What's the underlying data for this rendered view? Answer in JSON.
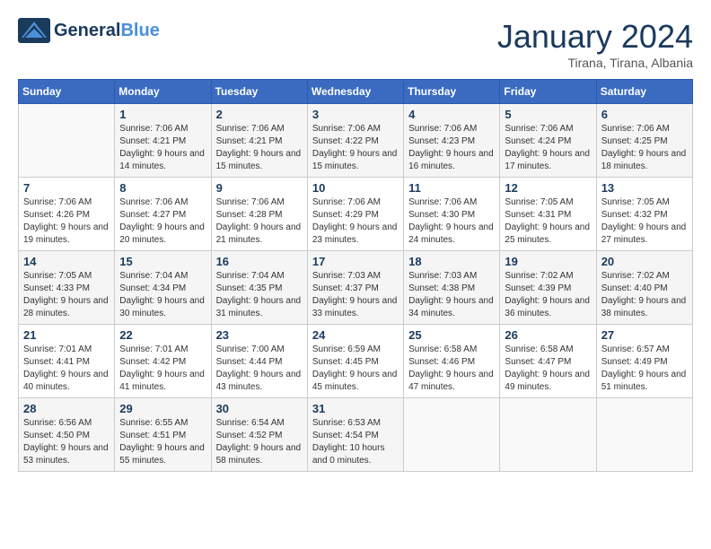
{
  "header": {
    "logo_general": "General",
    "logo_blue": "Blue",
    "month_title": "January 2024",
    "subtitle": "Tirana, Tirana, Albania"
  },
  "days_of_week": [
    "Sunday",
    "Monday",
    "Tuesday",
    "Wednesday",
    "Thursday",
    "Friday",
    "Saturday"
  ],
  "weeks": [
    [
      {
        "day": "",
        "sunrise": "",
        "sunset": "",
        "daylight": ""
      },
      {
        "day": "1",
        "sunrise": "Sunrise: 7:06 AM",
        "sunset": "Sunset: 4:21 PM",
        "daylight": "Daylight: 9 hours and 14 minutes."
      },
      {
        "day": "2",
        "sunrise": "Sunrise: 7:06 AM",
        "sunset": "Sunset: 4:21 PM",
        "daylight": "Daylight: 9 hours and 15 minutes."
      },
      {
        "day": "3",
        "sunrise": "Sunrise: 7:06 AM",
        "sunset": "Sunset: 4:22 PM",
        "daylight": "Daylight: 9 hours and 15 minutes."
      },
      {
        "day": "4",
        "sunrise": "Sunrise: 7:06 AM",
        "sunset": "Sunset: 4:23 PM",
        "daylight": "Daylight: 9 hours and 16 minutes."
      },
      {
        "day": "5",
        "sunrise": "Sunrise: 7:06 AM",
        "sunset": "Sunset: 4:24 PM",
        "daylight": "Daylight: 9 hours and 17 minutes."
      },
      {
        "day": "6",
        "sunrise": "Sunrise: 7:06 AM",
        "sunset": "Sunset: 4:25 PM",
        "daylight": "Daylight: 9 hours and 18 minutes."
      }
    ],
    [
      {
        "day": "7",
        "sunrise": "Sunrise: 7:06 AM",
        "sunset": "Sunset: 4:26 PM",
        "daylight": "Daylight: 9 hours and 19 minutes."
      },
      {
        "day": "8",
        "sunrise": "Sunrise: 7:06 AM",
        "sunset": "Sunset: 4:27 PM",
        "daylight": "Daylight: 9 hours and 20 minutes."
      },
      {
        "day": "9",
        "sunrise": "Sunrise: 7:06 AM",
        "sunset": "Sunset: 4:28 PM",
        "daylight": "Daylight: 9 hours and 21 minutes."
      },
      {
        "day": "10",
        "sunrise": "Sunrise: 7:06 AM",
        "sunset": "Sunset: 4:29 PM",
        "daylight": "Daylight: 9 hours and 23 minutes."
      },
      {
        "day": "11",
        "sunrise": "Sunrise: 7:06 AM",
        "sunset": "Sunset: 4:30 PM",
        "daylight": "Daylight: 9 hours and 24 minutes."
      },
      {
        "day": "12",
        "sunrise": "Sunrise: 7:05 AM",
        "sunset": "Sunset: 4:31 PM",
        "daylight": "Daylight: 9 hours and 25 minutes."
      },
      {
        "day": "13",
        "sunrise": "Sunrise: 7:05 AM",
        "sunset": "Sunset: 4:32 PM",
        "daylight": "Daylight: 9 hours and 27 minutes."
      }
    ],
    [
      {
        "day": "14",
        "sunrise": "Sunrise: 7:05 AM",
        "sunset": "Sunset: 4:33 PM",
        "daylight": "Daylight: 9 hours and 28 minutes."
      },
      {
        "day": "15",
        "sunrise": "Sunrise: 7:04 AM",
        "sunset": "Sunset: 4:34 PM",
        "daylight": "Daylight: 9 hours and 30 minutes."
      },
      {
        "day": "16",
        "sunrise": "Sunrise: 7:04 AM",
        "sunset": "Sunset: 4:35 PM",
        "daylight": "Daylight: 9 hours and 31 minutes."
      },
      {
        "day": "17",
        "sunrise": "Sunrise: 7:03 AM",
        "sunset": "Sunset: 4:37 PM",
        "daylight": "Daylight: 9 hours and 33 minutes."
      },
      {
        "day": "18",
        "sunrise": "Sunrise: 7:03 AM",
        "sunset": "Sunset: 4:38 PM",
        "daylight": "Daylight: 9 hours and 34 minutes."
      },
      {
        "day": "19",
        "sunrise": "Sunrise: 7:02 AM",
        "sunset": "Sunset: 4:39 PM",
        "daylight": "Daylight: 9 hours and 36 minutes."
      },
      {
        "day": "20",
        "sunrise": "Sunrise: 7:02 AM",
        "sunset": "Sunset: 4:40 PM",
        "daylight": "Daylight: 9 hours and 38 minutes."
      }
    ],
    [
      {
        "day": "21",
        "sunrise": "Sunrise: 7:01 AM",
        "sunset": "Sunset: 4:41 PM",
        "daylight": "Daylight: 9 hours and 40 minutes."
      },
      {
        "day": "22",
        "sunrise": "Sunrise: 7:01 AM",
        "sunset": "Sunset: 4:42 PM",
        "daylight": "Daylight: 9 hours and 41 minutes."
      },
      {
        "day": "23",
        "sunrise": "Sunrise: 7:00 AM",
        "sunset": "Sunset: 4:44 PM",
        "daylight": "Daylight: 9 hours and 43 minutes."
      },
      {
        "day": "24",
        "sunrise": "Sunrise: 6:59 AM",
        "sunset": "Sunset: 4:45 PM",
        "daylight": "Daylight: 9 hours and 45 minutes."
      },
      {
        "day": "25",
        "sunrise": "Sunrise: 6:58 AM",
        "sunset": "Sunset: 4:46 PM",
        "daylight": "Daylight: 9 hours and 47 minutes."
      },
      {
        "day": "26",
        "sunrise": "Sunrise: 6:58 AM",
        "sunset": "Sunset: 4:47 PM",
        "daylight": "Daylight: 9 hours and 49 minutes."
      },
      {
        "day": "27",
        "sunrise": "Sunrise: 6:57 AM",
        "sunset": "Sunset: 4:49 PM",
        "daylight": "Daylight: 9 hours and 51 minutes."
      }
    ],
    [
      {
        "day": "28",
        "sunrise": "Sunrise: 6:56 AM",
        "sunset": "Sunset: 4:50 PM",
        "daylight": "Daylight: 9 hours and 53 minutes."
      },
      {
        "day": "29",
        "sunrise": "Sunrise: 6:55 AM",
        "sunset": "Sunset: 4:51 PM",
        "daylight": "Daylight: 9 hours and 55 minutes."
      },
      {
        "day": "30",
        "sunrise": "Sunrise: 6:54 AM",
        "sunset": "Sunset: 4:52 PM",
        "daylight": "Daylight: 9 hours and 58 minutes."
      },
      {
        "day": "31",
        "sunrise": "Sunrise: 6:53 AM",
        "sunset": "Sunset: 4:54 PM",
        "daylight": "Daylight: 10 hours and 0 minutes."
      },
      {
        "day": "",
        "sunrise": "",
        "sunset": "",
        "daylight": ""
      },
      {
        "day": "",
        "sunrise": "",
        "sunset": "",
        "daylight": ""
      },
      {
        "day": "",
        "sunrise": "",
        "sunset": "",
        "daylight": ""
      }
    ]
  ]
}
